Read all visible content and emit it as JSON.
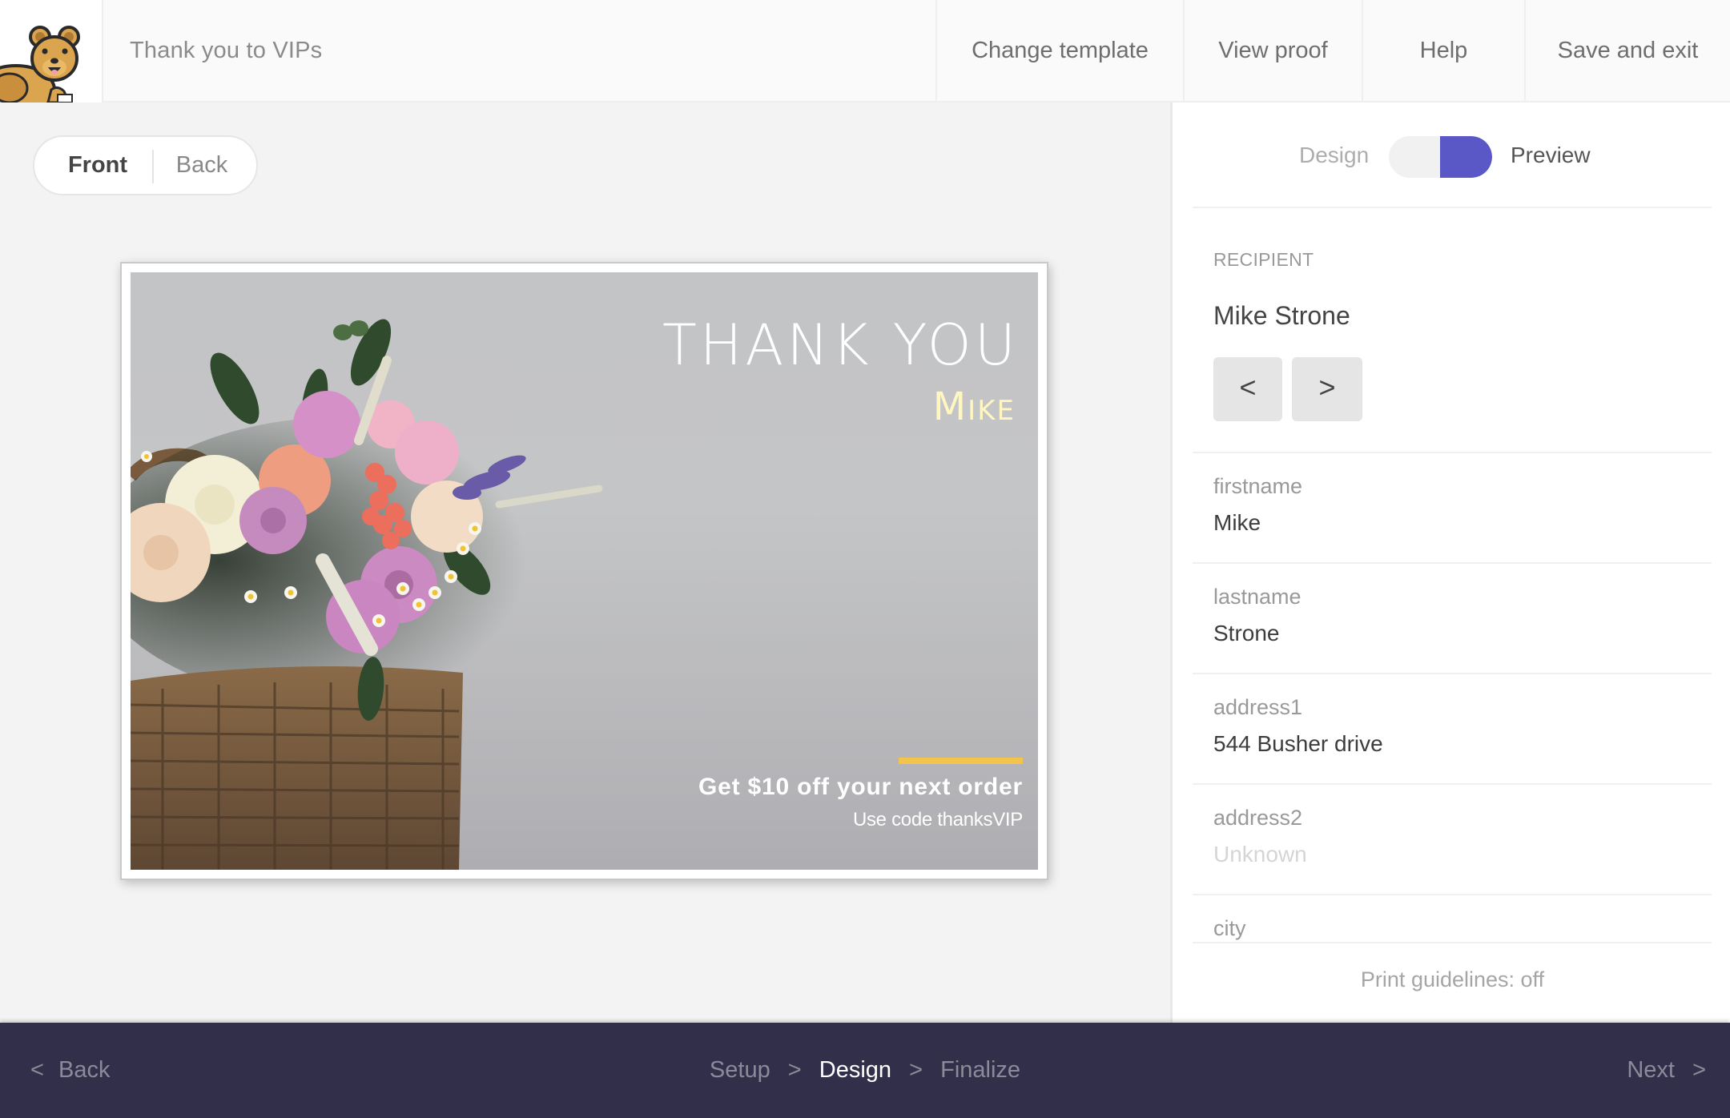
{
  "header": {
    "logo": "quokka-mascot",
    "title": "Thank you to VIPs",
    "nav": [
      {
        "label": "Change template"
      },
      {
        "label": "View proof"
      },
      {
        "label": "Help"
      },
      {
        "label": "Save and exit"
      }
    ]
  },
  "workspace": {
    "side_toggle": {
      "front": "Front",
      "back": "Back",
      "selected": "Front"
    },
    "card": {
      "title": "THANK YOU",
      "name": "Mike",
      "offer": "Get $10 off your next order",
      "code_line": "Use code thanksVIP",
      "accent_bar_color": "#f2c44c",
      "name_color": "#fff6c0",
      "image": "flower-basket-photo"
    }
  },
  "panel": {
    "mode_toggle": {
      "left_label": "Design",
      "right_label": "Preview",
      "selected": "Preview",
      "accent": "#5a57c6"
    },
    "recipient": {
      "section_label": "RECIPIENT",
      "name": "Mike Strone",
      "prev_label": "<",
      "next_label": ">"
    },
    "fields": [
      {
        "label": "firstname",
        "value": "Mike"
      },
      {
        "label": "lastname",
        "value": "Strone"
      },
      {
        "label": "address1",
        "value": "544 Busher drive"
      },
      {
        "label": "address2",
        "value": "Unknown",
        "empty": true
      },
      {
        "label": "city",
        "value": ""
      }
    ],
    "print_guidelines": "Print guidelines: off"
  },
  "footer": {
    "back_icon": "<",
    "back_label": "Back",
    "steps": [
      {
        "label": "Setup",
        "active": false
      },
      {
        "label": "Design",
        "active": true
      },
      {
        "label": "Finalize",
        "active": false
      }
    ],
    "step_separator": ">",
    "next_label": "Next",
    "next_icon": ">",
    "bg_color": "#322f4b"
  }
}
